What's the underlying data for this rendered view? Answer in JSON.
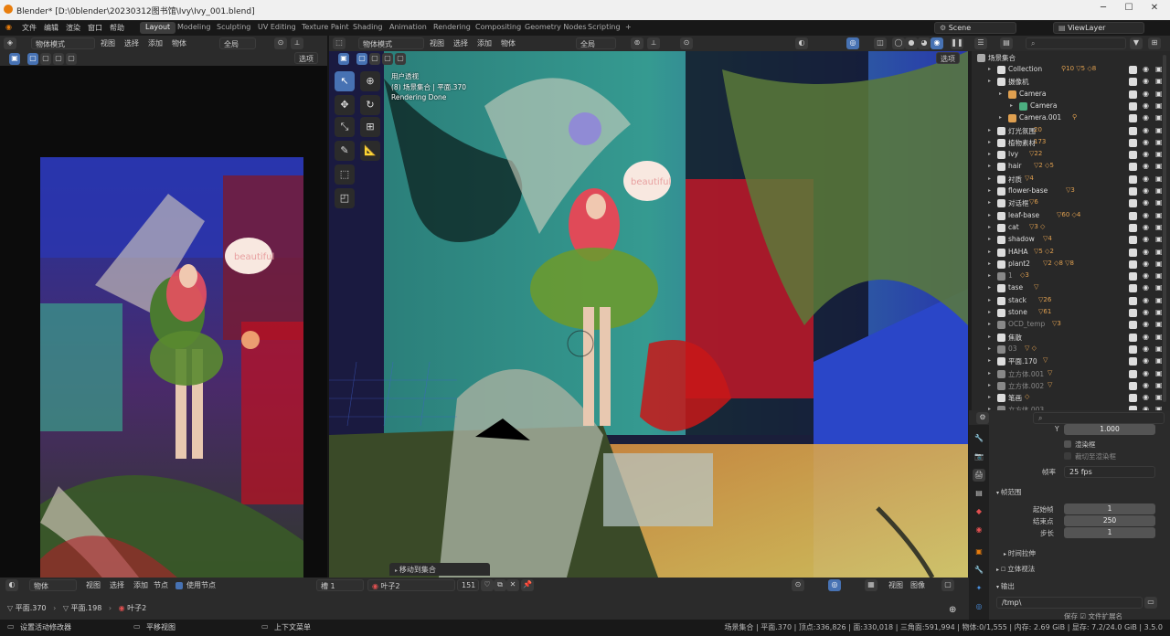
{
  "window": {
    "title": "Blender* [D:\\0blender\\20230312图书馆\\Ivy\\Ivy_001.blend]"
  },
  "menu": [
    "文件",
    "编辑",
    "渲染",
    "窗口",
    "帮助"
  ],
  "workspaces": [
    "Layout",
    "Modeling",
    "Sculpting",
    "UV Editing",
    "Texture Paint",
    "Shading",
    "Animation",
    "Rendering",
    "Compositing",
    "Geometry Nodes",
    "Scripting"
  ],
  "add_tab": "+",
  "scene": {
    "name": "Scene",
    "view_layer": "ViewLayer"
  },
  "left_header": {
    "mode": "物体模式",
    "items": [
      "视图",
      "选择",
      "添加",
      "物体"
    ],
    "orientation": "全局",
    "options": "选项"
  },
  "viewport_header": {
    "mode": "物体模式",
    "items": [
      "视图",
      "选择",
      "添加",
      "物体"
    ],
    "orientation": "全局",
    "options": "选项"
  },
  "overlay": {
    "line1": "用户透视",
    "line2": "(8) 场景集合 | 平面.370",
    "line3": "Rendering Done"
  },
  "speech_bubble": "beautiful",
  "move_to_collection": "移动到集合",
  "outliner": {
    "root": "场景集合",
    "items": [
      {
        "label": "Collection",
        "indent": 1,
        "color": "#dddddd",
        "extra": "⚲10 ▽5 ◇8"
      },
      {
        "label": "摄像机",
        "indent": 1,
        "color": "#dddddd",
        "extra": ""
      },
      {
        "label": "Camera",
        "indent": 2,
        "color": "#e0a050",
        "extra": ""
      },
      {
        "label": "Camera",
        "indent": 3,
        "color": "#4caf80",
        "extra": ""
      },
      {
        "label": "Camera.001",
        "indent": 2,
        "color": "#e0a050",
        "extra": "⚲"
      },
      {
        "label": "灯光氛围",
        "indent": 1,
        "color": "#dddddd",
        "extra": "20"
      },
      {
        "label": "植物素材",
        "indent": 1,
        "color": "#dddddd",
        "extra": "173"
      },
      {
        "label": "Ivy",
        "indent": 1,
        "color": "#dddddd",
        "extra": "▽22"
      },
      {
        "label": "hair",
        "indent": 1,
        "color": "#dddddd",
        "extra": "▽2 ◇5"
      },
      {
        "label": "衬质",
        "indent": 1,
        "color": "#dddddd",
        "extra": "▽4"
      },
      {
        "label": "flower-base",
        "indent": 1,
        "color": "#dddddd",
        "extra": "▽3"
      },
      {
        "label": "对话框",
        "indent": 1,
        "color": "#dddddd",
        "extra": "▽6"
      },
      {
        "label": "leaf-base",
        "indent": 1,
        "color": "#dddddd",
        "extra": "▽60 ◇4"
      },
      {
        "label": "cat",
        "indent": 1,
        "color": "#dddddd",
        "extra": "▽3 ◇"
      },
      {
        "label": "shadow",
        "indent": 1,
        "color": "#dddddd",
        "extra": "▽4"
      },
      {
        "label": "HAHA",
        "indent": 1,
        "color": "#dddddd",
        "extra": "▽5 ◇2"
      },
      {
        "label": "plant2",
        "indent": 1,
        "color": "#dddddd",
        "extra": "▽2 ◇8 ▽8"
      },
      {
        "label": "1",
        "indent": 1,
        "color": "#888888",
        "extra": "◇3"
      },
      {
        "label": "tase",
        "indent": 1,
        "color": "#dddddd",
        "extra": "▽"
      },
      {
        "label": "stack",
        "indent": 1,
        "color": "#dddddd",
        "extra": "▽26"
      },
      {
        "label": "stone",
        "indent": 1,
        "color": "#dddddd",
        "extra": "▽61"
      },
      {
        "label": "OCD_temp",
        "indent": 1,
        "color": "#888888",
        "extra": "▽3"
      },
      {
        "label": "焦散",
        "indent": 1,
        "color": "#dddddd",
        "extra": ""
      },
      {
        "label": "03",
        "indent": 1,
        "color": "#888888",
        "extra": "▽ ◇"
      },
      {
        "label": "平面.170",
        "indent": 1,
        "color": "#dddddd",
        "extra": "▽"
      },
      {
        "label": "立方体.001",
        "indent": 1,
        "color": "#888888",
        "extra": "▽"
      },
      {
        "label": "立方体.002",
        "indent": 1,
        "color": "#888888",
        "extra": "▽"
      },
      {
        "label": "笔画",
        "indent": 1,
        "color": "#dddddd",
        "extra": "◇"
      },
      {
        "label": "立方体.003",
        "indent": 1,
        "color": "#888888",
        "extra": ""
      }
    ]
  },
  "properties": {
    "y_label": "Y",
    "y_value": "1.000",
    "render_region": "渲染框",
    "crop_region": "裁切至渲染框",
    "fps_label": "帧率",
    "fps_value": "25 fps",
    "frame_range_title": "帧范围",
    "frame_start_label": "起始帧",
    "frame_start": "1",
    "frame_end_label": "结束点",
    "frame_end": "250",
    "step_label": "步长",
    "step": "1",
    "time_stretch": "时间拉伸",
    "stereoscopy": "立体视法",
    "output_title": "输出",
    "output_path": "/tmp\\",
    "extra1": "保存",
    "extra2": "文件扩展名"
  },
  "bottom_header": {
    "editor": "物体",
    "items": [
      "视图",
      "选择",
      "添加",
      "节点"
    ],
    "use_nodes": "使用节点",
    "slot": "槽 1",
    "material": "叶子2",
    "users": "151",
    "view": "视图",
    "image": "图像"
  },
  "breadcrumb": {
    "obj": "平面.370",
    "mesh": "平面.198",
    "mat": "叶子2"
  },
  "status": {
    "left1": "设置活动修改器",
    "left2": "平移视图",
    "left3": "上下文菜单",
    "right": "场景集合 | 平面.370 | 顶点:336,826 | 面:330,018 | 三角面:591,994 | 物体:0/1,555 | 内存: 2.69 GiB | 显存: 7.2/24.0 GiB | 3.5.0"
  },
  "colors": {
    "accent": "#4772b3",
    "orange": "#e87d0d",
    "panel": "#2b2b2b",
    "outliner": "#282828"
  }
}
